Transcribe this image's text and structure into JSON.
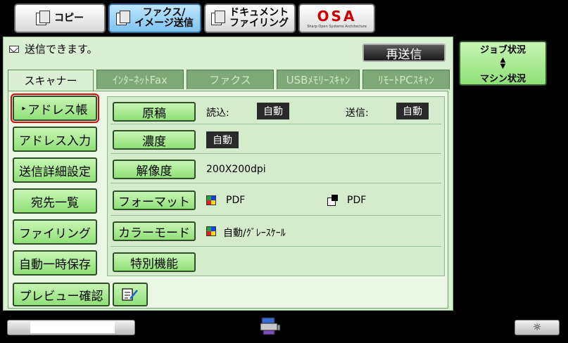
{
  "modes": [
    {
      "label": "コピー",
      "icon": "copy-icon",
      "active": false
    },
    {
      "label": "ファクス/\nイメージ送信",
      "icon": "fax-image-send-icon",
      "active": true
    },
    {
      "label": "ドキュメント\nファイリング",
      "icon": "document-filing-icon",
      "active": false
    }
  ],
  "logo": {
    "text": "OSA",
    "subtext": "Sharp Open Systems Architecture"
  },
  "status": {
    "message": "送信できます。"
  },
  "resend_label": "再送信",
  "tabs": [
    {
      "label": "スキャナー",
      "active": true
    },
    {
      "label": "ｲﾝﾀｰﾈｯﾄFax",
      "active": false
    },
    {
      "label": "ファクス",
      "active": false
    },
    {
      "label": "USBﾒﾓﾘｰｽｷｬﾝ",
      "active": false
    },
    {
      "label": "ﾘﾓｰﾄPCｽｷｬﾝ",
      "active": false
    }
  ],
  "side_menu": [
    {
      "label": "アドレス帳",
      "selected": true,
      "marker": "▸"
    },
    {
      "label": "アドレス入力",
      "selected": false
    },
    {
      "label": "送信詳細設定",
      "selected": false
    },
    {
      "label": "宛先一覧",
      "selected": false
    },
    {
      "label": "ファイリング",
      "selected": false
    },
    {
      "label": "自動一時保存",
      "selected": false
    }
  ],
  "features": {
    "original": {
      "label": "原稿",
      "read_label": "読込:",
      "read_value": "自動",
      "send_label": "送信:",
      "send_value": "自動"
    },
    "density": {
      "label": "濃度",
      "value": "自動"
    },
    "resolution": {
      "label": "解像度",
      "value": "200X200dpi"
    },
    "format": {
      "label": "フォーマット",
      "color_value": "PDF",
      "bw_value": "PDF"
    },
    "color_mode": {
      "label": "カラーモード",
      "value": "自動/ｸﾞﾚｰｽｹｰﾙ"
    },
    "special": {
      "label": "特別機能"
    }
  },
  "preview_label": "プレビュー確認",
  "job_status": {
    "top": "ジョブ状況",
    "bottom": "マシン状況"
  },
  "brightness_icon": "☼"
}
